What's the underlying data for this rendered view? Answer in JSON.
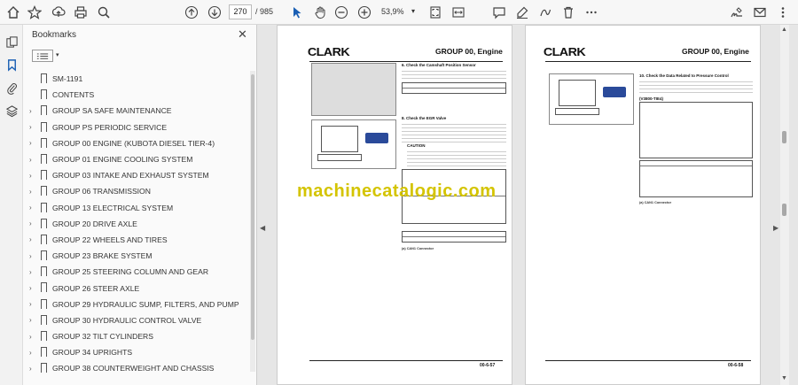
{
  "toolbar": {
    "page_current": "270",
    "page_total": "/ 985",
    "zoom": "53,9%",
    "zoom_caret": "▾"
  },
  "panel": {
    "title": "Bookmarks",
    "close": "✕",
    "options_caret": "▾"
  },
  "bookmarks": [
    {
      "label": "SM-1191",
      "expandable": false
    },
    {
      "label": "CONTENTS",
      "expandable": false
    },
    {
      "label": "GROUP SA SAFE MAINTENANCE",
      "expandable": true
    },
    {
      "label": "GROUP PS PERIODIC SERVICE",
      "expandable": true
    },
    {
      "label": "GROUP 00 ENGINE (KUBOTA DIESEL TIER-4)",
      "expandable": true
    },
    {
      "label": "GROUP 01 ENGINE COOLING SYSTEM",
      "expandable": true
    },
    {
      "label": "GROUP 03 INTAKE AND EXHAUST SYSTEM",
      "expandable": true
    },
    {
      "label": "GROUP 06 TRANSMISSION",
      "expandable": true
    },
    {
      "label": "GROUP 13 ELECTRICAL SYSTEM",
      "expandable": true
    },
    {
      "label": "GROUP 20 DRIVE AXLE",
      "expandable": true
    },
    {
      "label": "GROUP 22 WHEELS AND TIRES",
      "expandable": true
    },
    {
      "label": "GROUP 23 BRAKE SYSTEM",
      "expandable": true
    },
    {
      "label": "GROUP 25 STEERING COLUMN AND GEAR",
      "expandable": true
    },
    {
      "label": "GROUP 26 STEER AXLE",
      "expandable": true
    },
    {
      "label": "GROUP 29 HYDRAULIC SUMP, FILTERS, AND PUMP",
      "expandable": true
    },
    {
      "label": "GROUP 30 HYDRAULIC CONTROL VALVE",
      "expandable": true
    },
    {
      "label": "GROUP 32 TILT CYLINDERS",
      "expandable": true
    },
    {
      "label": "GROUP 34 UPRIGHTS",
      "expandable": true
    },
    {
      "label": "GROUP 38 COUNTERWEIGHT AND CHASSIS",
      "expandable": true
    }
  ],
  "left_page": {
    "logo": "CLARK",
    "group": "GROUP 00, Engine",
    "section1": "6. Check the Camshaft Position Sensor",
    "section2": "8. Check the EGR Valve",
    "caution": "CAUTION",
    "caption": "(a)  CAN1 Connector",
    "page_number": "00-6-57"
  },
  "right_page": {
    "logo": "CLARK",
    "group": "GROUP 00, Engine",
    "section1": "10. Check the Data Related to Pressure Control",
    "sub": "(V3800-TIE4)",
    "caption": "(a)  CAN1 Connector",
    "page_number": "00-6-58"
  },
  "watermark": "machinecatalogic.com",
  "icons": {
    "home": "home-icon",
    "star": "star-icon",
    "upload": "upload-icon",
    "print": "print-icon",
    "zoom-search": "search-icon"
  }
}
